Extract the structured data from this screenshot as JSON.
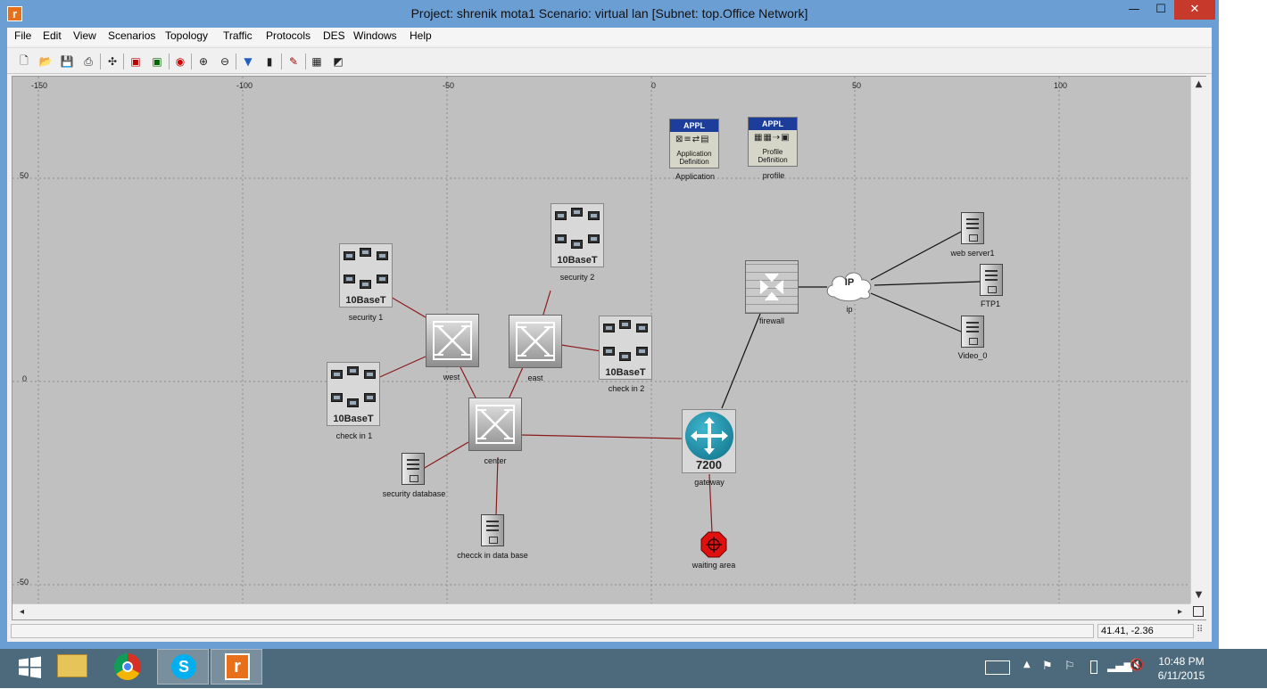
{
  "window": {
    "title": "Project: shrenik mota1 Scenario: virtual lan  [Subnet: top.Office Network]",
    "app_icon": "r",
    "minimize": "—",
    "maximize": "☐",
    "close": "✕"
  },
  "menu": [
    "File",
    "Edit",
    "View",
    "Scenarios",
    "Topology",
    "Traffic",
    "Protocols",
    "DES",
    "Windows",
    "Help"
  ],
  "toolbar_icons": [
    "new-icon",
    "open-icon",
    "save-icon",
    "print-icon",
    "open-palette-icon",
    "check-link-icon",
    "fail-node-icon",
    "recover-icon",
    "return-parent-icon",
    "zoom-in-icon",
    "zoom-out-icon",
    "ace-icon",
    "run-simulation-icon",
    "view-results-icon",
    "hide-graphs-icon",
    "graph-icon"
  ],
  "axes": {
    "x_ticks": [
      "-150",
      "-100",
      "-50",
      "0",
      "50",
      "100"
    ],
    "y_ticks": [
      "50",
      "0",
      "-50"
    ]
  },
  "nodes": {
    "application": {
      "label": "Application",
      "head": "APPL",
      "sub1": "Application",
      "sub2": "Definition"
    },
    "profile": {
      "label": "profile",
      "head": "APPL",
      "sub1": "Profile",
      "sub2": "Definition"
    },
    "security1": {
      "label": "security 1",
      "hub": "10BaseT"
    },
    "security2": {
      "label": "security 2",
      "hub": "10BaseT"
    },
    "checkin1": {
      "label": "check in 1",
      "hub": "10BaseT"
    },
    "checkin2": {
      "label": "check in 2",
      "hub": "10BaseT"
    },
    "west": {
      "label": "west"
    },
    "east": {
      "label": "east"
    },
    "center": {
      "label": "center"
    },
    "security_db": {
      "label": "security database"
    },
    "checkin_db": {
      "label": "checck in data base"
    },
    "gateway": {
      "label": "gateway",
      "model": "7200"
    },
    "waiting": {
      "label": "waiting area"
    },
    "firewall": {
      "label": "firewall"
    },
    "ip": {
      "label": "ip",
      "cloud": "IP"
    },
    "web_server": {
      "label": "web server1"
    },
    "ftp": {
      "label": "FTP1"
    },
    "video": {
      "label": "Video_0"
    }
  },
  "status": {
    "coords": "41.41, -2.36"
  },
  "taskbar": {
    "time": "10:48 PM",
    "date": "6/11/2015"
  },
  "colors": {
    "link_red": "#8b1a1a",
    "link_black": "#111111",
    "titlebar": "#6b9fd4",
    "close_button": "#c7392a"
  }
}
